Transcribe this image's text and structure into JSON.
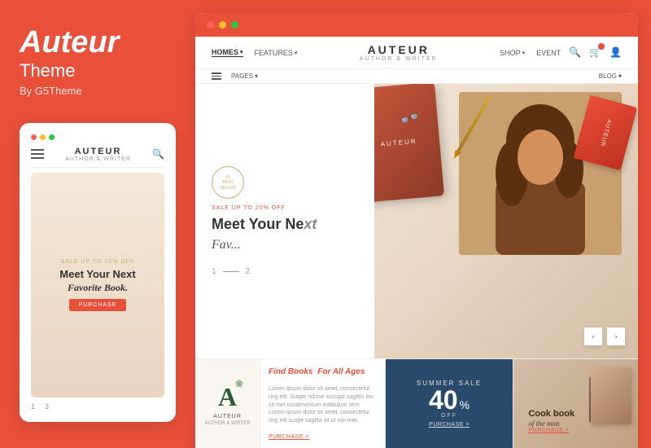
{
  "app": {
    "brand": {
      "name": "Auteur",
      "subtitle": "Theme",
      "by": "By G5Theme"
    }
  },
  "mobile": {
    "brand_name": "AUTEUR",
    "brand_tagline": "AUTHOR & WRITER",
    "hero_badge": "SALE UP TO 20% OFF",
    "hero_title": "Meet Your Next",
    "hero_subtitle": "Favorite Book.",
    "hero_btn": "PURCHASE",
    "page_current": "1",
    "page_separator": "—",
    "page_total": "3"
  },
  "browser": {
    "site_name": "AUTEUR",
    "site_tagline": "AUTHOR & WRITER",
    "nav": {
      "homes": "HOMES",
      "features": "FEATURES",
      "shop": "SHOP",
      "event": "EVENT",
      "pages": "PAGES",
      "blog": "BLOG"
    },
    "hero": {
      "award_line1": "#1",
      "award_line2": "BEST",
      "award_line3": "SELLER",
      "badge": "SALE UP TO 20% OFF",
      "title": "Meet Your Ne",
      "title2": "xt",
      "subtitle": "Fav...",
      "page_current": "1",
      "page_separator": "—",
      "page_next": "2"
    },
    "cards": {
      "logo": {
        "letter": "A",
        "brand": "AUTEUR",
        "tagline": "AUTHOR & WRITER"
      },
      "find_books": {
        "title": "Find Books",
        "title_italic": "For All Ages",
        "body": "Lorem ipsum dolor sit amet, consectetur ring elit. Suspe ndisse suscipit sagittis leo sit met condimentum estibulum sem Lorem ipsum dolor sit amet, consectetur ring elit suspe sagitta sit ut nisi met.",
        "link": "PURCHASE >"
      },
      "summer_sale": {
        "label": "SUMMER SALE",
        "percent": "40",
        "sup": "%",
        "off": "OFF",
        "link": "PURCHASE >"
      },
      "cookbook": {
        "title": "Cook book",
        "subtitle": "of the mon",
        "link": "PURCHASE >"
      }
    }
  },
  "icons": {
    "search": "🔍",
    "cart": "🛒",
    "user": "👤",
    "prev": "‹",
    "next": "›",
    "dropdown": "▾"
  }
}
